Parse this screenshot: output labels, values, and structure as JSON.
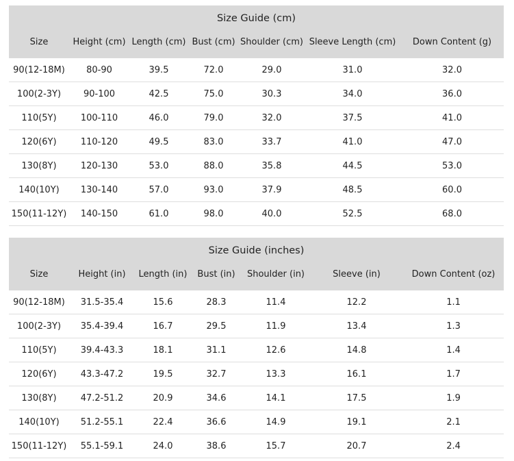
{
  "cm_table": {
    "title": "Size Guide (cm)",
    "headers": [
      "Size",
      "Height (cm)",
      "Length (cm)",
      "Bust (cm)",
      "Shoulder (cm)",
      "Sleeve Length (cm)",
      "Down Content (g)"
    ],
    "rows": [
      [
        "90(12-18M)",
        "80-90",
        "39.5",
        "72.0",
        "29.0",
        "31.0",
        "32.0"
      ],
      [
        "100(2-3Y)",
        "90-100",
        "42.5",
        "75.0",
        "30.3",
        "34.0",
        "36.0"
      ],
      [
        "110(5Y)",
        "100-110",
        "46.0",
        "79.0",
        "32.0",
        "37.5",
        "41.0"
      ],
      [
        "120(6Y)",
        "110-120",
        "49.5",
        "83.0",
        "33.7",
        "41.0",
        "47.0"
      ],
      [
        "130(8Y)",
        "120-130",
        "53.0",
        "88.0",
        "35.8",
        "44.5",
        "53.0"
      ],
      [
        "140(10Y)",
        "130-140",
        "57.0",
        "93.0",
        "37.9",
        "48.5",
        "60.0"
      ],
      [
        "150(11-12Y)",
        "140-150",
        "61.0",
        "98.0",
        "40.0",
        "52.5",
        "68.0"
      ]
    ]
  },
  "inch_table": {
    "title": "Size Guide (inches)",
    "headers": [
      "Size",
      "Height (in)",
      "Length (in)",
      "Bust (in)",
      "Shoulder (in)",
      "Sleeve (in)",
      "Down Content (oz)"
    ],
    "rows": [
      [
        "90(12-18M)",
        "31.5-35.4",
        "15.6",
        "28.3",
        "11.4",
        "12.2",
        "1.1"
      ],
      [
        "100(2-3Y)",
        "35.4-39.4",
        "16.7",
        "29.5",
        "11.9",
        "13.4",
        "1.3"
      ],
      [
        "110(5Y)",
        "39.4-43.3",
        "18.1",
        "31.1",
        "12.6",
        "14.8",
        "1.4"
      ],
      [
        "120(6Y)",
        "43.3-47.2",
        "19.5",
        "32.7",
        "13.3",
        "16.1",
        "1.7"
      ],
      [
        "130(8Y)",
        "47.2-51.2",
        "20.9",
        "34.6",
        "14.1",
        "17.5",
        "1.9"
      ],
      [
        "140(10Y)",
        "51.2-55.1",
        "22.4",
        "36.6",
        "14.9",
        "19.1",
        "2.1"
      ],
      [
        "150(11-12Y)",
        "55.1-59.1",
        "24.0",
        "38.6",
        "15.7",
        "20.7",
        "2.4"
      ]
    ]
  }
}
